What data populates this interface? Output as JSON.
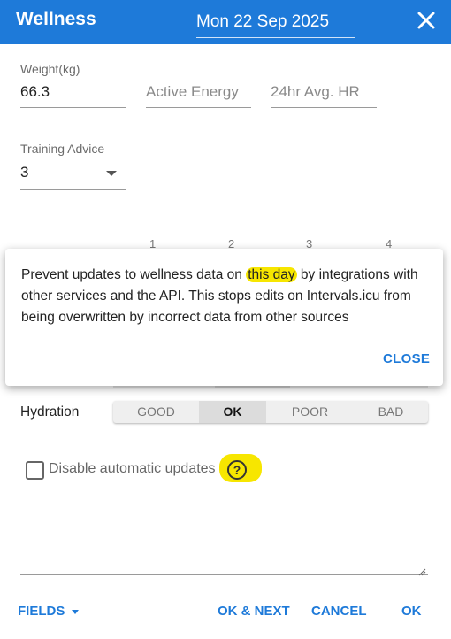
{
  "header": {
    "title": "Wellness",
    "date": "Mon 22 Sep 2025",
    "close_icon": "close-icon"
  },
  "fields": {
    "weight": {
      "label": "Weight(kg)",
      "value": "66.3"
    },
    "active_energy": {
      "placeholder": "Active Energy"
    },
    "avg_hr": {
      "placeholder": "24hr Avg. HR"
    },
    "training_advice": {
      "label": "Training Advice",
      "value": "3"
    }
  },
  "scale_numbers": [
    "1",
    "2",
    "3",
    "4"
  ],
  "popup": {
    "text_before": "Prevent updates to wellness data on ",
    "text_highlight": "this day",
    "text_after": " by integrations with other services and the API. This stops edits on Intervals.icu from being overwritten by incorrect data from other sources",
    "close_label": "CLOSE"
  },
  "hydration": {
    "label": "Hydration",
    "options": [
      "GOOD",
      "OK",
      "POOR",
      "BAD"
    ],
    "selected": "OK"
  },
  "disable_updates": {
    "label": "Disable automatic updates",
    "checked": false
  },
  "footer": {
    "fields_label": "FIELDS",
    "ok_next_label": "OK & NEXT",
    "cancel_label": "CANCEL",
    "ok_label": "OK"
  },
  "colors": {
    "accent": "#1e7ad9",
    "highlight": "#f7e600"
  }
}
